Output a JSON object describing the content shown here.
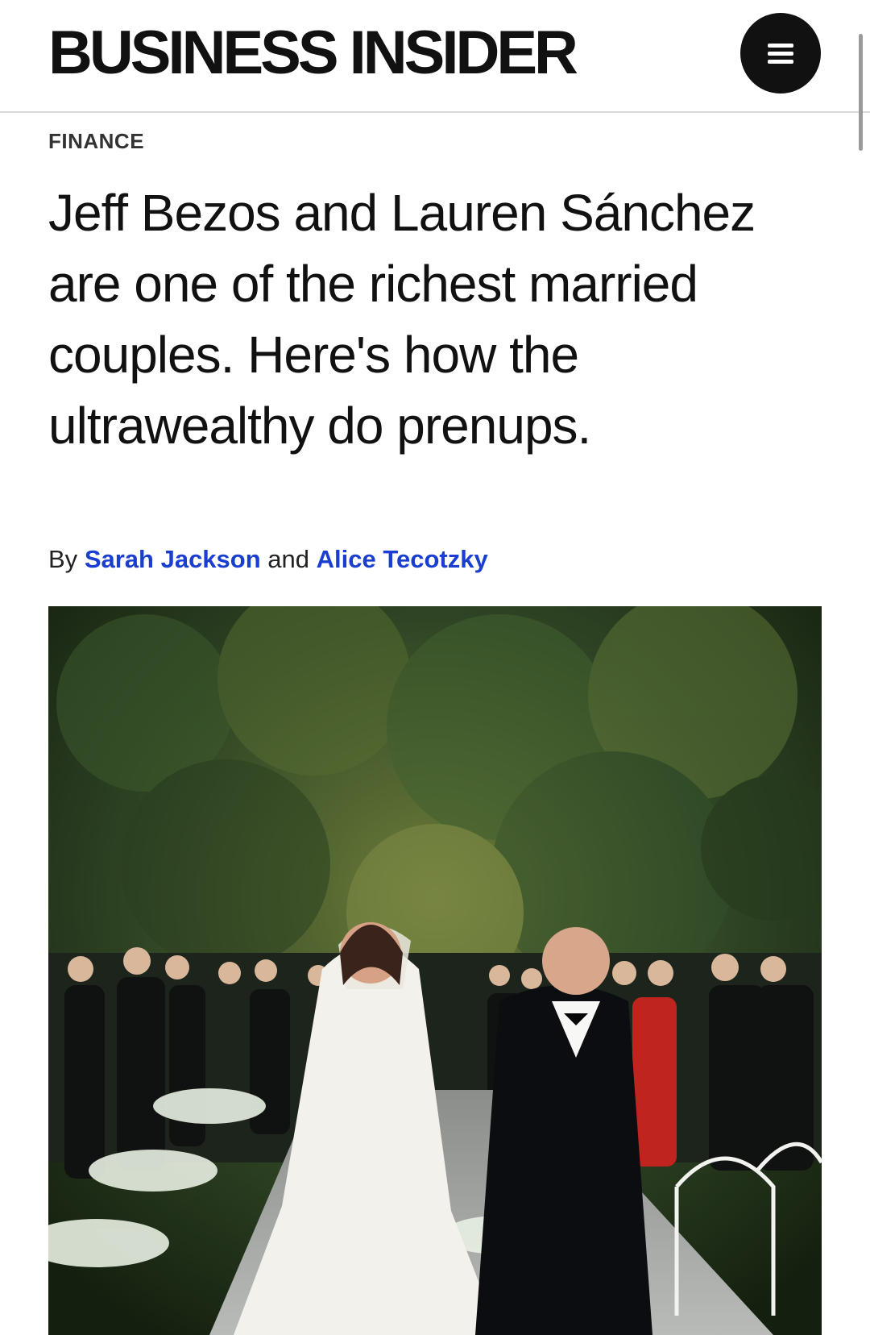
{
  "header": {
    "logo_text": "BUSINESS INSIDER",
    "menu_icon": "hamburger-menu-icon"
  },
  "article": {
    "section": "FINANCE",
    "headline": "Jeff Bezos and Lauren Sánchez are one of the richest married couples. Here's how the ultrawealthy do prenups.",
    "byline": {
      "prefix": "By",
      "author1": "Sarah Jackson",
      "joiner": "and",
      "author2": "Alice Tecotzky"
    }
  },
  "colors": {
    "author_link": "#1a3fd0",
    "logo": "#111111",
    "menu_button": "#111111"
  }
}
